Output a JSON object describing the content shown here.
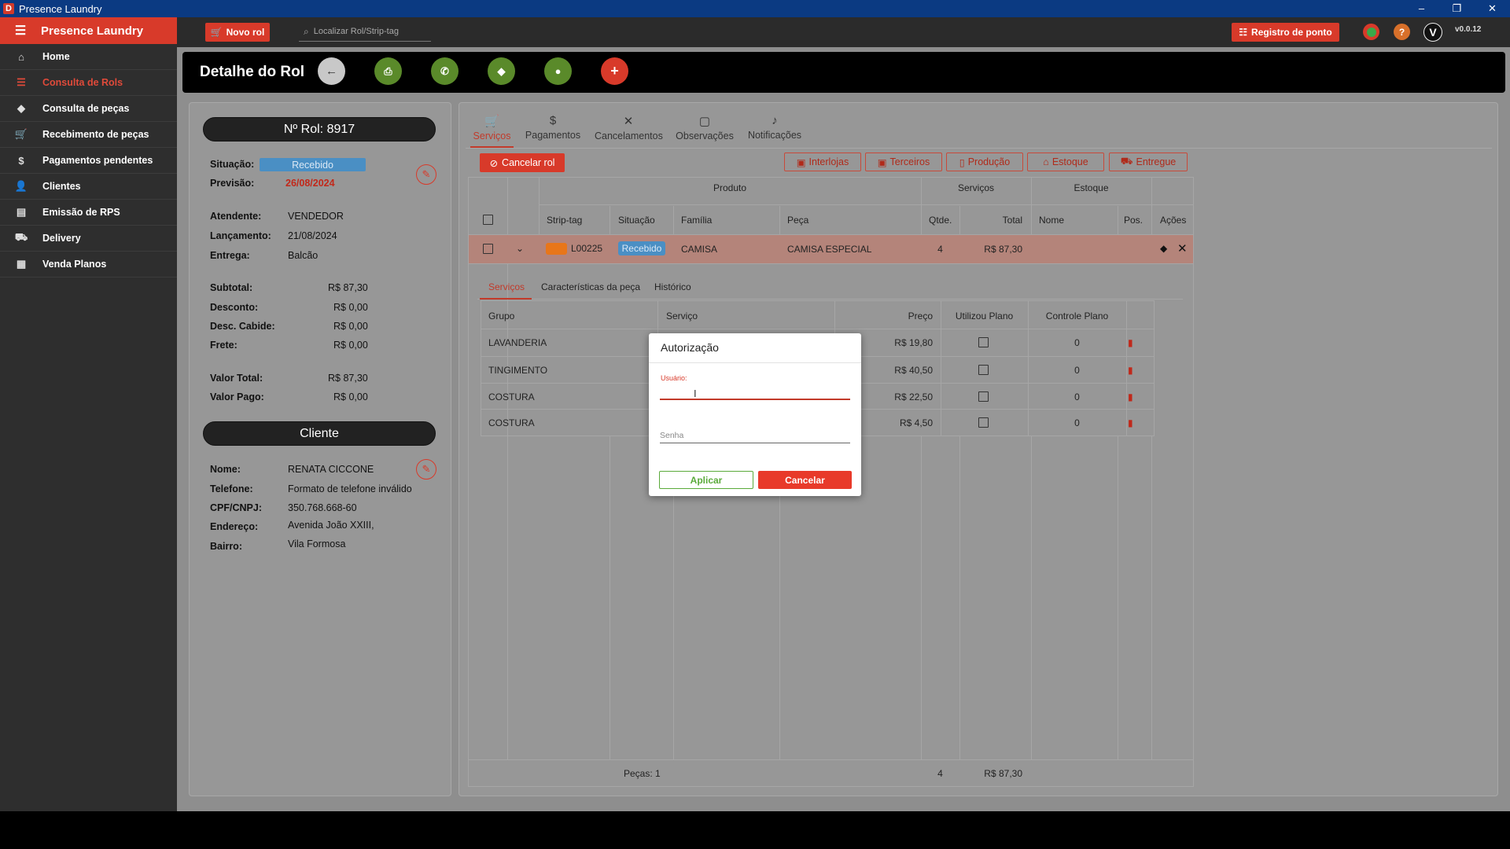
{
  "window": {
    "title": "Presence Laundry",
    "controls": [
      "–",
      "❐",
      "✕"
    ]
  },
  "sidebar": {
    "brand": "Presence Laundry",
    "items": [
      {
        "label": "Home",
        "icon": "home-icon",
        "glyph": "⌂"
      },
      {
        "label": "Consulta de Rols",
        "icon": "list-icon",
        "glyph": "☰"
      },
      {
        "label": "Consulta de peças",
        "icon": "tag-icon",
        "glyph": "◆"
      },
      {
        "label": "Recebimento de peças",
        "icon": "cart-icon",
        "glyph": "🛒"
      },
      {
        "label": "Pagamentos pendentes",
        "icon": "dollar-icon",
        "glyph": "$"
      },
      {
        "label": "Clientes",
        "icon": "user-icon",
        "glyph": "👤"
      },
      {
        "label": "Emissão de RPS",
        "icon": "receipt-icon",
        "glyph": "▤"
      },
      {
        "label": "Delivery",
        "icon": "truck-icon",
        "glyph": "⛟"
      },
      {
        "label": "Venda Planos",
        "icon": "plan-icon",
        "glyph": "▦"
      }
    ],
    "active_index": 1
  },
  "topbar": {
    "new_rol": "Novo rol",
    "search_placeholder": "Localizar Rol/Strip-tag",
    "registro": "Registro de ponto",
    "avatar_letter": "V",
    "version": "v0.0.12"
  },
  "header": {
    "title": "Detalhe do Rol"
  },
  "rol": {
    "number_label": "Nº Rol: 8917",
    "situacao_label": "Situação:",
    "situacao": "Recebido",
    "previsao_label": "Previsão:",
    "previsao": "26/08/2024",
    "atendente_label": "Atendente:",
    "atendente": "VENDEDOR",
    "lancamento_label": "Lançamento:",
    "lancamento": "21/08/2024",
    "entrega_label": "Entrega:",
    "entrega": "Balcão",
    "subtotal_label": "Subtotal:",
    "subtotal": "R$ 87,30",
    "desconto_label": "Desconto:",
    "desconto": "R$ 0,00",
    "desc_cabide_label": "Desc. Cabide:",
    "desc_cabide": "R$ 0,00",
    "frete_label": "Frete:",
    "frete": "R$ 0,00",
    "valor_total_label": "Valor Total:",
    "valor_total": "R$ 87,30",
    "valor_pago_label": "Valor Pago:",
    "valor_pago": "R$ 0,00"
  },
  "cliente": {
    "header": "Cliente",
    "nome_label": "Nome:",
    "nome": "RENATA CICCONE",
    "telefone_label": "Telefone:",
    "telefone": "Formato de telefone inválido",
    "cpf_label": "CPF/CNPJ:",
    "cpf": "350.768.668-60",
    "endereco_label": "Endereço:",
    "endereco": "Avenida João XXIII,",
    "bairro_label": "Bairro:",
    "bairro": "Vila Formosa"
  },
  "tabs": [
    "Serviços",
    "Pagamentos",
    "Cancelamentos",
    "Observações",
    "Notificações"
  ],
  "actions": {
    "cancelar_rol": "Cancelar rol",
    "interlojas": "Interlojas",
    "terceiros": "Terceiros",
    "producao": "Produção",
    "estoque": "Estoque",
    "entregue": "Entregue"
  },
  "table": {
    "groups": {
      "produto": "Produto",
      "servicos": "Serviços",
      "estoque": "Estoque"
    },
    "columns": [
      "Strip-tag",
      "Situação",
      "Família",
      "Peça",
      "Qtde.",
      "Total",
      "Nome",
      "Pos.",
      "Ações"
    ],
    "row": {
      "strip_tag": "L00225",
      "situacao": "Recebido",
      "familia": "CAMISA",
      "peca": "CAMISA ESPECIAL",
      "qtde": "4",
      "total": "R$ 87,30"
    },
    "subtabs": [
      "Serviços",
      "Características da peça",
      "Histórico"
    ],
    "sub_columns": [
      "Grupo",
      "Serviço",
      "Preço",
      "Utilizou Plano",
      "Controle Plano"
    ],
    "services": [
      {
        "grupo": "LAVANDERIA",
        "preco": "R$ 19,80",
        "controle": "0"
      },
      {
        "grupo": "TINGIMENTO",
        "preco": "R$ 40,50",
        "controle": "0"
      },
      {
        "grupo": "COSTURA",
        "preco": "R$ 22,50",
        "controle": "0"
      },
      {
        "grupo": "COSTURA",
        "preco": "R$ 4,50",
        "controle": "0"
      }
    ],
    "footer": {
      "pecas": "Peças: 1",
      "qtde": "4",
      "total": "R$ 87,30"
    }
  },
  "modal": {
    "title": "Autorização",
    "user_label": "Usuário:",
    "password_placeholder": "Senha",
    "apply": "Aplicar",
    "cancel": "Cancelar"
  },
  "colors": {
    "accent": "#d83a2a",
    "status_blue": "#4a8fc4",
    "apply_green": "#5aaa3a",
    "tag_orange": "#e8761a"
  }
}
